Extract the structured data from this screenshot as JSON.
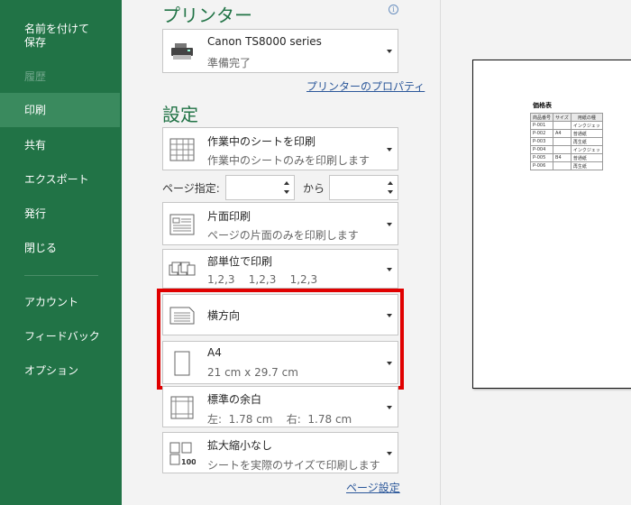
{
  "sidebar": {
    "items": [
      {
        "label": "名前を付けて\n保存",
        "state": "normal"
      },
      {
        "label": "履歴",
        "state": "disabled"
      },
      {
        "label": "印刷",
        "state": "selected"
      },
      {
        "label": "共有",
        "state": "normal"
      },
      {
        "label": "エクスポート",
        "state": "normal"
      },
      {
        "label": "発行",
        "state": "normal"
      },
      {
        "label": "閉じる",
        "state": "normal"
      },
      {
        "label": "アカウント",
        "state": "normal"
      },
      {
        "label": "フィードバック",
        "state": "normal"
      },
      {
        "label": "オプション",
        "state": "normal"
      }
    ]
  },
  "printer": {
    "section_title": "プリンター",
    "name": "Canon TS8000 series",
    "status": "準備完了",
    "properties_link": "プリンターのプロパティ",
    "info_glyph": "i"
  },
  "settings": {
    "section_title": "設定",
    "print_what": {
      "title": "作業中のシートを印刷",
      "subtitle": "作業中のシートのみを印刷します"
    },
    "pages": {
      "label": "ページ指定:",
      "from_value": "",
      "to_label": "から",
      "to_value": ""
    },
    "sides": {
      "title": "片面印刷",
      "subtitle": "ページの片面のみを印刷します"
    },
    "collation": {
      "title": "部単位で印刷",
      "subtitle": "1,2,3    1,2,3    1,2,3"
    },
    "orientation": {
      "title": "横方向"
    },
    "paper": {
      "title": "A4",
      "subtitle": "21 cm x 29.7 cm"
    },
    "margins": {
      "title": "標準の余白",
      "subtitle": "左:  1.78 cm    右:  1.78 cm"
    },
    "scaling": {
      "title": "拡大縮小なし",
      "subtitle": "シートを実際のサイズで印刷します"
    },
    "page_setup_link": "ページ設定"
  },
  "preview": {
    "title": "価格表",
    "headers": [
      "商品番号",
      "サイズ",
      "用紙の種"
    ],
    "rows": [
      [
        "P-001",
        "",
        "インクジェッ"
      ],
      [
        "P-002",
        "A4",
        "普通紙"
      ],
      [
        "P-003",
        "",
        "再生紙"
      ],
      [
        "P-004",
        "",
        "インクジェッ"
      ],
      [
        "P-005",
        "B4",
        "普通紙"
      ],
      [
        "P-006",
        "",
        "再生紙"
      ]
    ]
  },
  "colors": {
    "sidebar_bg": "#217346",
    "accent": "#217346",
    "highlight": "#e00000",
    "link": "#2b579a"
  }
}
